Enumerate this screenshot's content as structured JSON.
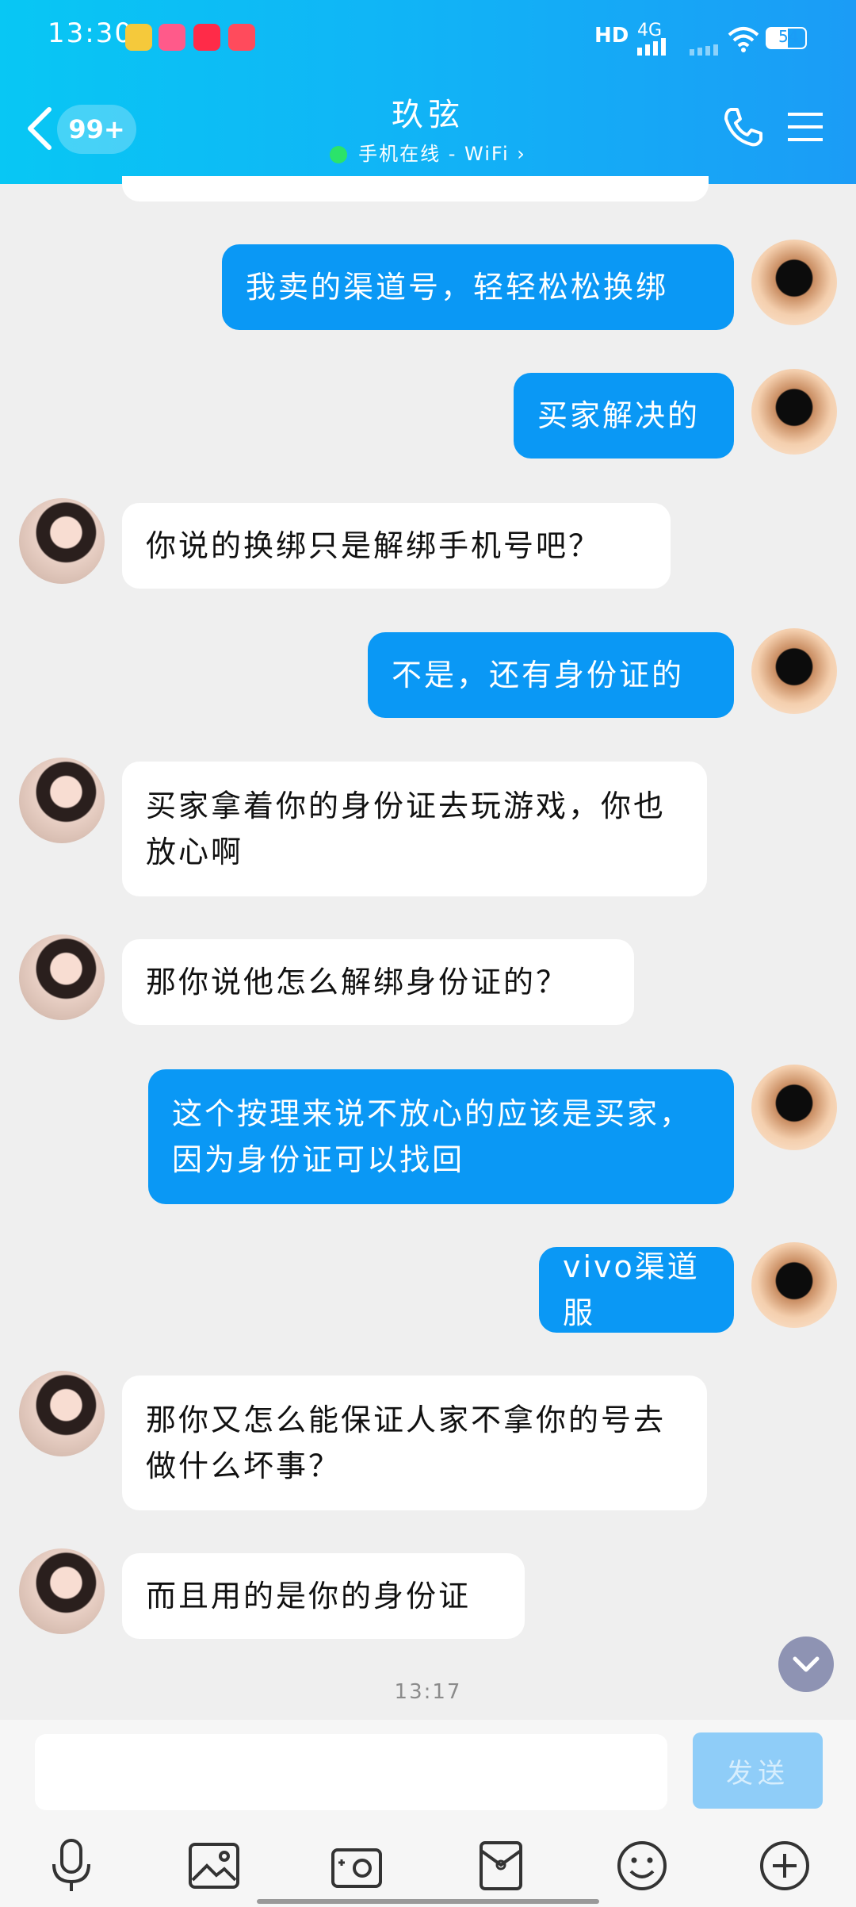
{
  "status_bar": {
    "time": "13:30",
    "network": "4G",
    "battery": "54",
    "hd": "HD"
  },
  "header": {
    "unread_count": "99+",
    "contact_name": "玖弦",
    "contact_status": "手机在线 - WiFi"
  },
  "messages": [
    {
      "side": "out",
      "text": "我卖的渠道号，轻轻松松换绑"
    },
    {
      "side": "out",
      "text": "买家解决的"
    },
    {
      "side": "in",
      "text": "你说的换绑只是解绑手机号吧？"
    },
    {
      "side": "out",
      "text": "不是，还有身份证的"
    },
    {
      "side": "in",
      "text": "买家拿着你的身份证去玩游戏，你也放心啊"
    },
    {
      "side": "in",
      "text": "那你说他怎么解绑身份证的？"
    },
    {
      "side": "out",
      "text": "这个按理来说不放心的应该是买家，因为身份证可以找回"
    },
    {
      "side": "out",
      "text": "vivo渠道服"
    },
    {
      "side": "in",
      "text": "那你又怎么能保证人家不拿你的号去做什么坏事？"
    },
    {
      "side": "in",
      "text": "而且用的是你的身份证"
    }
  ],
  "timestamp": "13:17",
  "input": {
    "placeholder": "",
    "value": "",
    "send_label": "发送"
  },
  "colors": {
    "accent": "#0a98f5",
    "header_start": "#08c7f4",
    "header_end": "#1b9cf6"
  }
}
